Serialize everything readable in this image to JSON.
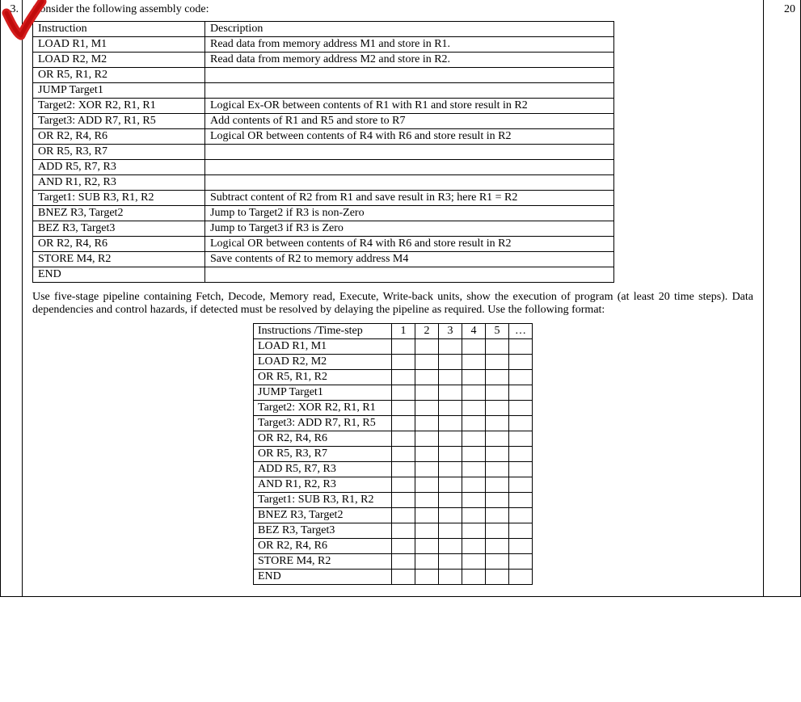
{
  "question_number": "3.",
  "marks": "20",
  "intro_text": "Consider the following assembly code:",
  "instr_table": {
    "header": {
      "c1": "Instruction",
      "c2": "Description"
    },
    "rows": [
      {
        "c1": "LOAD R1, M1",
        "c2": "Read data from memory address M1 and store in R1."
      },
      {
        "c1": "LOAD R2, M2",
        "c2": "Read data from memory address M2 and store in R2."
      },
      {
        "c1": "OR R5, R1, R2",
        "c2": ""
      },
      {
        "c1": "JUMP Target1",
        "c2": ""
      },
      {
        "c1": "Target2: XOR R2, R1, R1",
        "c2": "Logical Ex-OR between contents of R1 with R1 and store result in R2"
      },
      {
        "c1": "Target3: ADD R7, R1, R5",
        "c2": "Add contents of R1 and R5 and store to R7"
      },
      {
        "c1": "OR R2, R4, R6",
        "c2": "Logical OR between contents of R4 with R6 and store result in R2"
      },
      {
        "c1": "OR R5, R3, R7",
        "c2": ""
      },
      {
        "c1": "ADD R5, R7, R3",
        "c2": ""
      },
      {
        "c1": "AND R1, R2, R3",
        "c2": ""
      },
      {
        "c1": "Target1: SUB R3, R1, R2",
        "c2": "Subtract content of R2 from R1 and save result in R3; here R1 = R2"
      },
      {
        "c1": "BNEZ R3, Target2",
        "c2": "Jump to Target2 if R3 is non-Zero"
      },
      {
        "c1": "BEZ R3, Target3",
        "c2": "Jump to Target3 if R3 is Zero"
      },
      {
        "c1": "OR R2, R4, R6",
        "c2": "Logical OR between contents of R4 with R6 and store result in R2"
      },
      {
        "c1": "STORE M4, R2",
        "c2": "Save contents of R2 to memory address M4"
      },
      {
        "c1": "END",
        "c2": ""
      }
    ]
  },
  "paragraph": "Use five-stage pipeline containing Fetch, Decode, Memory read, Execute, Write-back units, show the execution of program (at least 20 time steps). Data dependencies and control hazards, if detected must be resolved by delaying the pipeline as required. Use the following format:",
  "timeline": {
    "header_label": "Instructions /Time-step",
    "steps": [
      "1",
      "2",
      "3",
      "4",
      "5",
      "…"
    ],
    "rows": [
      "LOAD R1, M1",
      "LOAD R2, M2",
      "OR R5, R1, R2",
      "JUMP Target1",
      "Target2: XOR R2, R1, R1",
      "Target3: ADD R7, R1, R5",
      "OR R2, R4, R6",
      "OR R5, R3, R7",
      "ADD R5, R7, R3",
      "AND R1, R2, R3",
      "Target1: SUB R3, R1, R2",
      "BNEZ R3, Target2",
      "BEZ R3, Target3",
      "OR R2, R4, R6",
      "STORE M4, R2",
      "END"
    ]
  }
}
